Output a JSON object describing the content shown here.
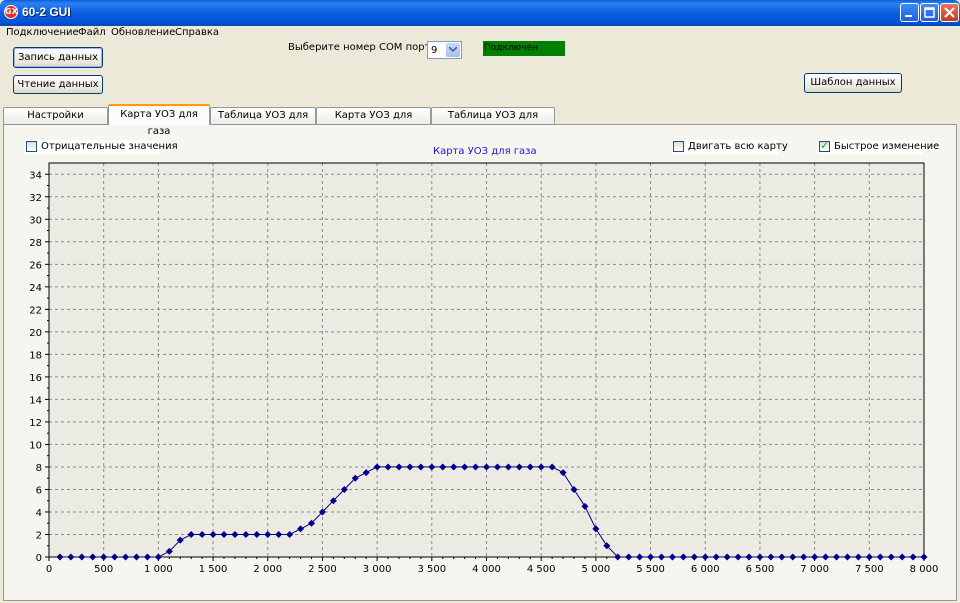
{
  "window": {
    "title": "60-2 GUI",
    "app_icon": "GX",
    "minimize_icon": "minimize-icon",
    "maximize_icon": "maximize-icon",
    "close_icon": "close-icon"
  },
  "menu": [
    "Подключение",
    "Файл",
    "Обновление",
    "Справка"
  ],
  "buttons": {
    "write": "Запись данных",
    "read": "Чтение данных",
    "template": "Шаблон данных"
  },
  "com": {
    "label": "Выберите номер COM порта",
    "value": "9",
    "status": "Подключен",
    "status_color": "#008000"
  },
  "tabs": [
    {
      "label": "Настройки вариатора",
      "active": false
    },
    {
      "label": "Карта УОЗ для газа",
      "active": true
    },
    {
      "label": "Таблица УОЗ для газа",
      "active": false
    },
    {
      "label": "Карта УОЗ для бензина",
      "active": false
    },
    {
      "label": "Таблица УОЗ для бензина",
      "active": false
    }
  ],
  "options": {
    "negative": {
      "label": "Отрицательные значения",
      "checked": false
    },
    "move_map": {
      "label": "Двигать всю карту",
      "checked": false
    },
    "fast_change": {
      "label": "Быстрое изменение",
      "checked": true
    }
  },
  "chart_data": {
    "type": "line",
    "title": "Карта УОЗ для газа",
    "xlabel": "",
    "ylabel": "",
    "xlim": [
      0,
      8000
    ],
    "ylim": [
      0,
      35
    ],
    "x_ticks": [
      0,
      500,
      1000,
      1500,
      2000,
      2500,
      3000,
      3500,
      4000,
      4500,
      5000,
      5500,
      6000,
      6500,
      7000,
      7500,
      8000
    ],
    "x_tick_labels": [
      "0",
      "500",
      "1 000",
      "1 500",
      "2 000",
      "2 500",
      "3 000",
      "3 500",
      "4 000",
      "4 500",
      "5 000",
      "5 500",
      "6 000",
      "6 500",
      "7 000",
      "7 500",
      "8 000"
    ],
    "y_ticks": [
      0,
      2,
      4,
      6,
      8,
      10,
      12,
      14,
      16,
      18,
      20,
      22,
      24,
      26,
      28,
      30,
      32,
      34
    ],
    "grid": true,
    "line_color": "#00008b",
    "x": [
      100,
      200,
      300,
      400,
      500,
      600,
      700,
      800,
      900,
      1000,
      1100,
      1200,
      1300,
      1400,
      1500,
      1600,
      1700,
      1800,
      1900,
      2000,
      2100,
      2200,
      2300,
      2400,
      2500,
      2600,
      2700,
      2800,
      2900,
      3000,
      3100,
      3200,
      3300,
      3400,
      3500,
      3600,
      3700,
      3800,
      3900,
      4000,
      4100,
      4200,
      4300,
      4400,
      4500,
      4600,
      4700,
      4800,
      4900,
      5000,
      5100,
      5200,
      5300,
      5400,
      5500,
      5600,
      5700,
      5800,
      5900,
      6000,
      6100,
      6200,
      6300,
      6400,
      6500,
      6600,
      6700,
      6800,
      6900,
      7000,
      7100,
      7200,
      7300,
      7400,
      7500,
      7600,
      7700,
      7800,
      7900,
      8000
    ],
    "y": [
      0,
      0,
      0,
      0,
      0,
      0,
      0,
      0,
      0,
      0,
      0.5,
      1.5,
      2,
      2,
      2,
      2,
      2,
      2,
      2,
      2,
      2,
      2,
      2.5,
      3,
      4,
      5,
      6,
      7,
      7.5,
      8,
      8,
      8,
      8,
      8,
      8,
      8,
      8,
      8,
      8,
      8,
      8,
      8,
      8,
      8,
      8,
      8,
      7.5,
      6,
      4.5,
      2.5,
      1,
      0,
      0,
      0,
      0,
      0,
      0,
      0,
      0,
      0,
      0,
      0,
      0,
      0,
      0,
      0,
      0,
      0,
      0,
      0,
      0,
      0,
      0,
      0,
      0,
      0,
      0,
      0,
      0,
      0
    ]
  }
}
